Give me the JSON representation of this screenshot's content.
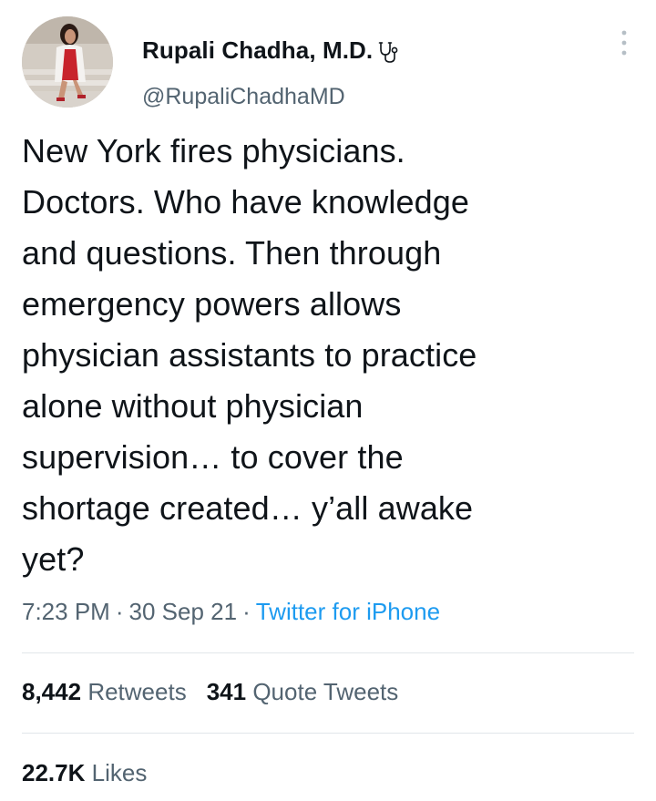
{
  "author": {
    "display_name": "Rupali Chadha, M.D.",
    "handle": "@RupaliChadhaMD",
    "badge_icon": "stethoscope-icon",
    "avatar": "avatar"
  },
  "tweet": {
    "text": "New York fires physicians.\nDoctors. Who have knowledge\nand questions. Then through\nemergency powers allows\nphysician assistants to practice\nalone without physician\nsupervision… to cover the\nshortage created… y’all awake\nyet?",
    "time": "7:23 PM",
    "date": "30 Sep 21",
    "separator": "·",
    "source": "Twitter for iPhone"
  },
  "stats": {
    "retweets_count": "8,442",
    "retweets_label": "Retweets",
    "quotes_count": "341",
    "quotes_label": "Quote Tweets",
    "likes_count": "22.7K",
    "likes_label": "Likes"
  },
  "colors": {
    "text": "#0f1419",
    "secondary": "#536471",
    "link": "#1d9bf0",
    "divider": "#e1e6ea"
  }
}
